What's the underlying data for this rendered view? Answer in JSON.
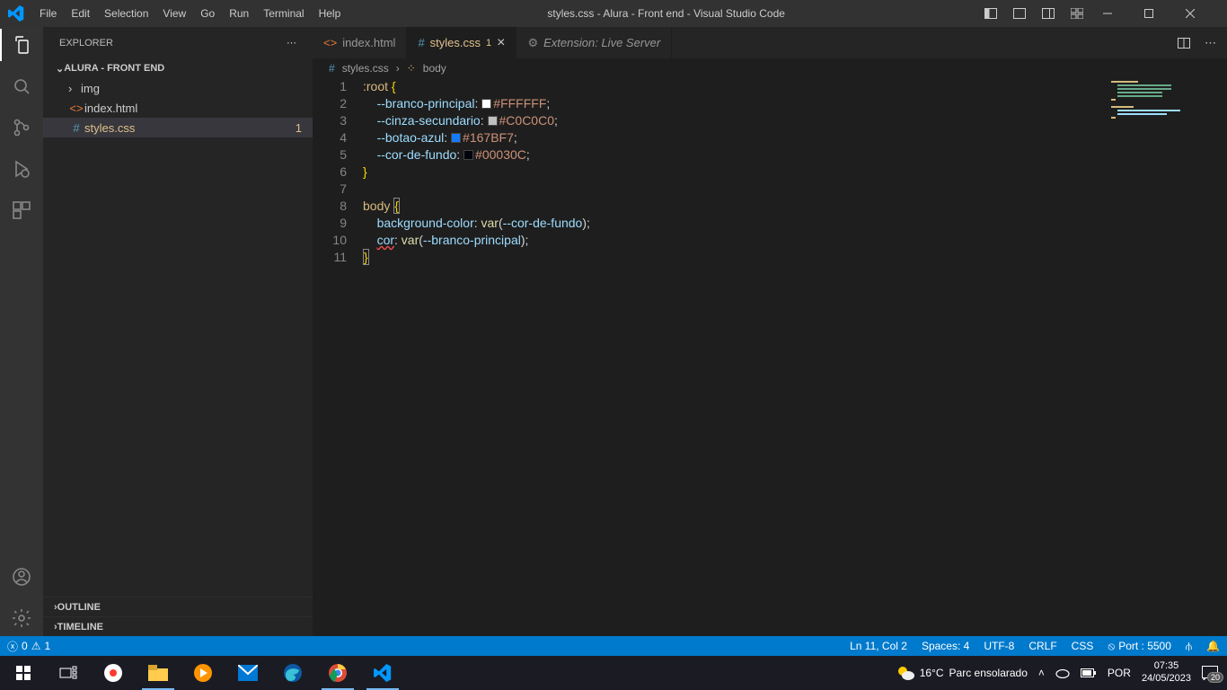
{
  "titlebar": {
    "menus": [
      "File",
      "Edit",
      "Selection",
      "View",
      "Go",
      "Run",
      "Terminal",
      "Help"
    ],
    "title": "styles.css - Alura - Front end - Visual Studio Code"
  },
  "sidebar": {
    "header": "EXPLORER",
    "section": "ALURA - FRONT END",
    "tree": {
      "folder": "img",
      "file_html": "index.html",
      "file_css": "styles.css",
      "css_badge": "1"
    },
    "outline": "OUTLINE",
    "timeline": "TIMELINE"
  },
  "tabs": {
    "t1": "index.html",
    "t2": "styles.css",
    "t2_badge": "1",
    "t3": "Extension: Live Server"
  },
  "breadcrumbs": {
    "file": "styles.css",
    "symbol": "body"
  },
  "code": {
    "lines": [
      "1",
      "2",
      "3",
      "4",
      "5",
      "6",
      "7",
      "8",
      "9",
      "10",
      "11"
    ],
    "s_root": ":root",
    "sp": " ",
    "ob": "{",
    "cb": "}",
    "var1": "--branco-principal",
    "var2": "--cinza-secundario",
    "var3": "--botao-azul",
    "var4": "--cor-de-fundo",
    "colon": ":",
    "semi": ";",
    "hex1": "#FFFFFF",
    "hex2": "#C0C0C0",
    "hex3": "#167BF7",
    "hex4": "#00030C",
    "s_body": "body",
    "prop_bg": "background-color",
    "prop_cor": "cor",
    "var_fn": "var",
    "op": "(",
    "cp": ")",
    "ref_fundo": "--cor-de-fundo",
    "ref_branco": "--branco-principal"
  },
  "statusbar": {
    "errors": "0",
    "warnings": "1",
    "position": "Ln 11, Col 2",
    "spaces": "Spaces: 4",
    "encoding": "UTF-8",
    "eol": "CRLF",
    "lang": "CSS",
    "port": "Port : 5500"
  },
  "taskbar": {
    "weather_temp": "16°C",
    "weather_desc": "Parc ensolarado",
    "lang": "POR",
    "time": "07:35",
    "date": "24/05/2023",
    "notif": "20"
  }
}
